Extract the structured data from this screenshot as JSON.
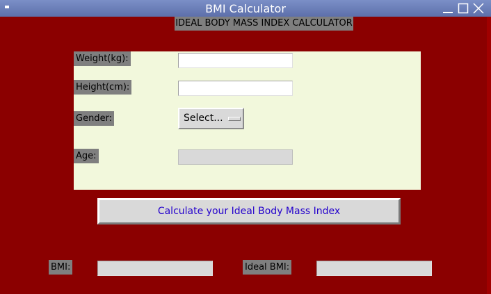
{
  "window": {
    "title": "BMI Calculator"
  },
  "header": {
    "title": "IDEAL BODY MASS INDEX CALCULATOR"
  },
  "form": {
    "weight_label": "Weight(kg):",
    "weight_value": "",
    "height_label": "Height(cm):",
    "height_value": "",
    "gender_label": "Gender:",
    "gender_selected": "Select...",
    "age_label": "Age:",
    "age_value": ""
  },
  "actions": {
    "calculate_label": "Calculate your Ideal Body Mass Index"
  },
  "results": {
    "bmi_label": "BMI:",
    "bmi_value": "",
    "ideal_bmi_label": "Ideal BMI:",
    "ideal_bmi_value": ""
  },
  "colors": {
    "background": "#8b0000",
    "panel": "#f2f8dc",
    "label_bg": "#7f7f7f",
    "button_text": "#2300cc"
  }
}
